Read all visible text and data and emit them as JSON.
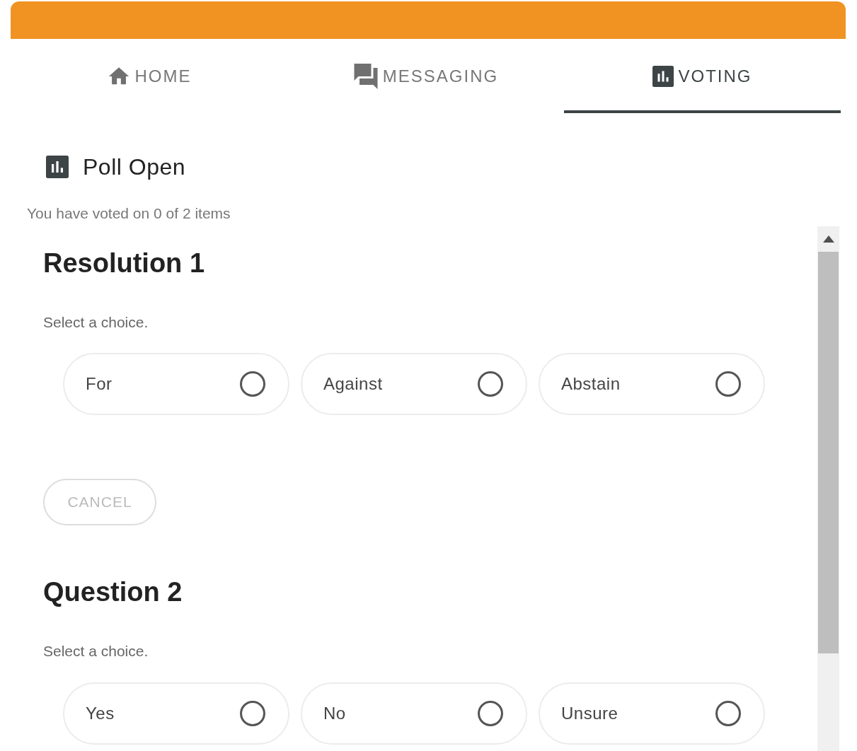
{
  "tabs": [
    {
      "label": "HOME",
      "kind": "home",
      "selected": false
    },
    {
      "label": "MESSAGING",
      "kind": "messaging",
      "selected": false
    },
    {
      "label": "VOTING",
      "kind": "voting",
      "selected": true
    }
  ],
  "poll": {
    "title": "Poll Open",
    "progress": "You have voted on 0 of 2 items"
  },
  "items": [
    {
      "title": "Resolution 1",
      "prompt": "Select a choice.",
      "choices": [
        {
          "label": "For",
          "selected": false
        },
        {
          "label": "Against",
          "selected": false
        },
        {
          "label": "Abstain",
          "selected": false
        }
      ],
      "cancel": {
        "label": "CANCEL",
        "disabled": true
      }
    },
    {
      "title": "Question 2",
      "prompt": "Select a choice.",
      "choices": [
        {
          "label": "Yes",
          "selected": false
        },
        {
          "label": "No",
          "selected": false
        },
        {
          "label": "Unsure",
          "selected": false
        }
      ]
    }
  ]
}
